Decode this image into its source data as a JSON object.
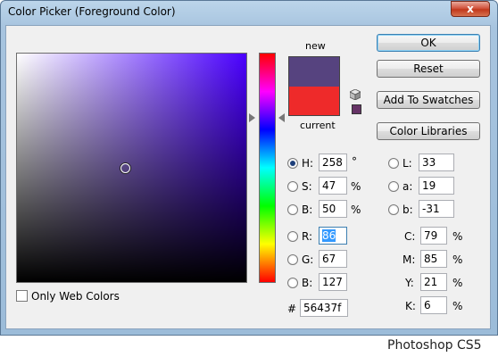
{
  "window": {
    "title": "Color Picker (Foreground Color)",
    "close": "x"
  },
  "swatch": {
    "new_label": "new",
    "current_label": "current",
    "new_color": "#56437f",
    "current_color": "#ee2a2a"
  },
  "buttons": {
    "ok": "OK",
    "reset": "Reset",
    "add_swatches": "Add To Swatches",
    "color_libraries": "Color Libraries"
  },
  "hsb": {
    "h": {
      "label": "H:",
      "value": "258",
      "unit": "°"
    },
    "s": {
      "label": "S:",
      "value": "47",
      "unit": "%"
    },
    "b": {
      "label": "B:",
      "value": "50",
      "unit": "%"
    }
  },
  "rgb": {
    "r": {
      "label": "R:",
      "value": "86"
    },
    "g": {
      "label": "G:",
      "value": "67"
    },
    "b": {
      "label": "B:",
      "value": "127"
    }
  },
  "lab": {
    "l": {
      "label": "L:",
      "value": "33"
    },
    "a": {
      "label": "a:",
      "value": "19"
    },
    "b": {
      "label": "b:",
      "value": "-31"
    }
  },
  "cmyk": {
    "c": {
      "label": "C:",
      "value": "79",
      "unit": "%"
    },
    "m": {
      "label": "M:",
      "value": "85",
      "unit": "%"
    },
    "y": {
      "label": "Y:",
      "value": "21",
      "unit": "%"
    },
    "k": {
      "label": "K:",
      "value": "6",
      "unit": "%"
    }
  },
  "hex": {
    "label": "#",
    "value": "56437f"
  },
  "web_colors_label": "Only Web Colors",
  "caption": "Photoshop CS5"
}
